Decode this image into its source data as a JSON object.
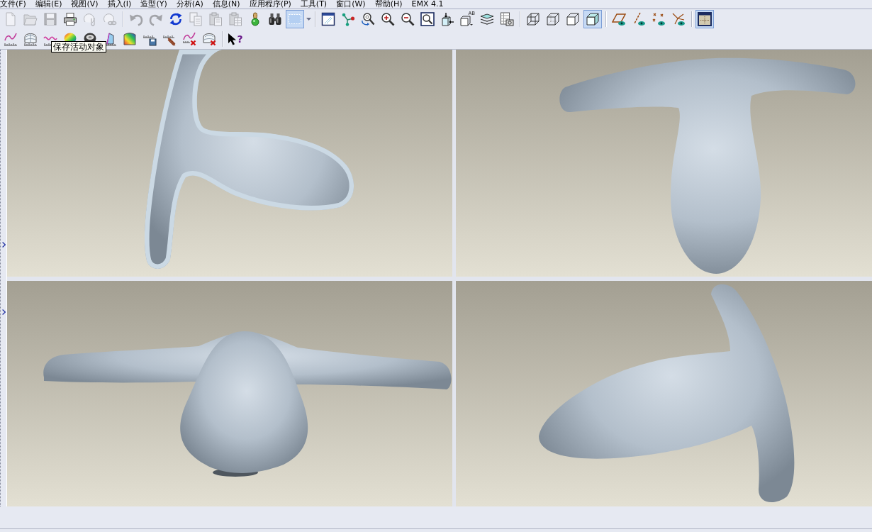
{
  "menu_bar": {
    "items": [
      "文件(F)",
      "编辑(E)",
      "视图(V)",
      "插入(I)",
      "造型(Y)",
      "分析(A)",
      "信息(N)",
      "应用程序(P)",
      "工具(T)",
      "窗口(W)",
      "帮助(H)",
      "EMX 4.1"
    ]
  },
  "toolbars": [
    {
      "groups": [
        {
          "buttons": [
            {
              "disabled": true,
              "pressed": false
            },
            {
              "disabled": true,
              "pressed": false
            },
            {
              "disabled": true,
              "pressed": false
            },
            {
              "disabled": false,
              "pressed": false
            },
            {
              "disabled": true,
              "pressed": false
            },
            {
              "disabled": true,
              "pressed": false
            }
          ]
        },
        {
          "buttons": [
            {
              "disabled": true,
              "pressed": false
            },
            {
              "disabled": true,
              "pressed": false
            },
            {
              "disabled": false,
              "pressed": false
            },
            {
              "disabled": true,
              "pressed": false
            },
            {
              "disabled": true,
              "pressed": false
            },
            {
              "disabled": true,
              "pressed": false
            },
            {
              "disabled": false,
              "pressed": false
            },
            {
              "disabled": false,
              "pressed": false
            },
            {
              "disabled": false,
              "pressed": true
            }
          ]
        },
        {
          "buttons": [
            {
              "disabled": false,
              "pressed": false
            },
            {
              "disabled": false,
              "pressed": false
            },
            {
              "disabled": false,
              "pressed": false
            },
            {
              "disabled": false,
              "pressed": false
            },
            {
              "disabled": false,
              "pressed": false
            },
            {
              "disabled": false,
              "pressed": false
            },
            {
              "disabled": false,
              "pressed": false
            },
            {
              "label": "AB",
              "disabled": false,
              "pressed": false
            },
            {
              "disabled": false,
              "pressed": false
            },
            {
              "disabled": false,
              "pressed": false
            }
          ]
        },
        {
          "buttons": [
            {
              "disabled": false,
              "pressed": false
            },
            {
              "disabled": false,
              "pressed": false
            },
            {
              "disabled": false,
              "pressed": false
            },
            {
              "disabled": false,
              "pressed": true
            }
          ]
        },
        {
          "buttons": [
            {
              "disabled": false,
              "pressed": false
            },
            {
              "disabled": false,
              "pressed": false
            },
            {
              "disabled": false,
              "pressed": false
            },
            {
              "disabled": false,
              "pressed": false
            }
          ]
        },
        {
          "buttons": [
            {
              "disabled": false,
              "pressed": true
            }
          ]
        }
      ]
    },
    {
      "groups": [
        {
          "buttons": [
            {
              "disabled": false,
              "pressed": false
            },
            {
              "disabled": false,
              "pressed": false
            },
            {
              "disabled": false,
              "pressed": false
            },
            {
              "disabled": false,
              "pressed": false
            },
            {
              "disabled": false,
              "pressed": false
            },
            {
              "disabled": false,
              "pressed": false
            },
            {
              "disabled": false,
              "pressed": false
            },
            {
              "disabled": false,
              "pressed": false
            },
            {
              "disabled": false,
              "pressed": false
            },
            {
              "disabled": false,
              "pressed": false
            },
            {
              "disabled": false,
              "pressed": false
            }
          ]
        },
        {
          "buttons": [
            {
              "label": "?",
              "disabled": false,
              "pressed": false
            }
          ]
        }
      ]
    }
  ],
  "tooltip": {
    "text": "保存活动对象"
  }
}
